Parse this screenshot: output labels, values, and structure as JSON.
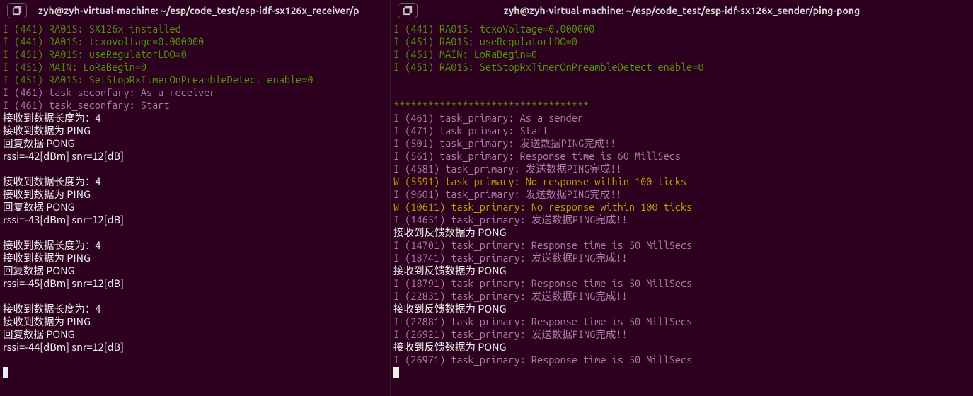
{
  "left": {
    "title": "zyh@zyh-virtual-machine: ~/esp/code_test/esp-idf-sx126x_receiver/p",
    "lines": [
      {
        "cls": "g",
        "text": "I (441) RA01S: SX126x installed"
      },
      {
        "cls": "g",
        "text": "I (441) RA01S: tcxoVoltage=0.000000"
      },
      {
        "cls": "g",
        "text": "I (451) RA01S: useRegulatorLDO=0"
      },
      {
        "cls": "g",
        "text": "I (451) MAIN: LoRaBegin=0"
      },
      {
        "cls": "g",
        "text": "I (451) RA01S: SetStopRxTimerOnPreambleDetect enable=0"
      },
      {
        "cls": "m",
        "text": "I (461) task_seconfary: As a receiver"
      },
      {
        "cls": "m",
        "text": "I (461) task_seconfary: Start"
      },
      {
        "cls": "w",
        "text": "接收到数据长度为：4"
      },
      {
        "cls": "w",
        "text": "接收到数据为 PING"
      },
      {
        "cls": "w",
        "text": "回复数据 PONG"
      },
      {
        "cls": "w",
        "text": "rssi=-42[dBm] snr=12[dB]"
      },
      {
        "cls": "w",
        "text": " "
      },
      {
        "cls": "w",
        "text": "接收到数据长度为：4"
      },
      {
        "cls": "w",
        "text": "接收到数据为 PING"
      },
      {
        "cls": "w",
        "text": "回复数据 PONG"
      },
      {
        "cls": "w",
        "text": "rssi=-43[dBm] snr=12[dB]"
      },
      {
        "cls": "w",
        "text": " "
      },
      {
        "cls": "w",
        "text": "接收到数据长度为：4"
      },
      {
        "cls": "w",
        "text": "接收到数据为 PING"
      },
      {
        "cls": "w",
        "text": "回复数据 PONG"
      },
      {
        "cls": "w",
        "text": "rssi=-45[dBm] snr=12[dB]"
      },
      {
        "cls": "w",
        "text": " "
      },
      {
        "cls": "w",
        "text": "接收到数据长度为：4"
      },
      {
        "cls": "w",
        "text": "接收到数据为 PING"
      },
      {
        "cls": "w",
        "text": "回复数据 PONG"
      },
      {
        "cls": "w",
        "text": "rssi=-44[dBm] snr=12[dB]"
      },
      {
        "cls": "w",
        "text": " "
      }
    ]
  },
  "right": {
    "title": "zyh@zyh-virtual-machine: ~/esp/code_test/esp-idf-sx126x_sender/ping-pong",
    "lines": [
      {
        "cls": "g",
        "text": "I (441) RA01S: tcxoVoltage=0.000000"
      },
      {
        "cls": "g",
        "text": "I (451) RA01S: useRegulatorLDO=0"
      },
      {
        "cls": "g",
        "text": "I (451) MAIN: LoRaBegin=0"
      },
      {
        "cls": "g",
        "text": "I (451) RA01S: SetStopRxTimerOnPreambleDetect enable=0"
      },
      {
        "cls": "w",
        "text": " "
      },
      {
        "cls": "w",
        "text": " "
      },
      {
        "cls": "stars",
        "text": "**********************************"
      },
      {
        "cls": "m",
        "text": "I (461) task_primary: As a sender"
      },
      {
        "cls": "m",
        "text": "I (471) task_primary: Start"
      },
      {
        "cls": "m",
        "text": "I (501) task_primary: 发送数据PING完成!!"
      },
      {
        "cls": "m",
        "text": "I (561) task_primary: Response time is 60 MillSecs"
      },
      {
        "cls": "m",
        "text": "I (4581) task_primary: 发送数据PING完成!!"
      },
      {
        "cls": "y",
        "text": "W (5591) task_primary: No response within 100 ticks"
      },
      {
        "cls": "m",
        "text": "I (9601) task_primary: 发送数据PING完成!!"
      },
      {
        "cls": "y",
        "text": "W (10611) task_primary: No response within 100 ticks"
      },
      {
        "cls": "m",
        "text": "I (14651) task_primary: 发送数据PING完成!!"
      },
      {
        "cls": "w",
        "text": "接收到反馈数据为 PONG"
      },
      {
        "cls": "m",
        "text": "I (14701) task_primary: Response time is 50 MillSecs"
      },
      {
        "cls": "m",
        "text": "I (18741) task_primary: 发送数据PING完成!!"
      },
      {
        "cls": "w",
        "text": "接收到反馈数据为 PONG"
      },
      {
        "cls": "m",
        "text": "I (18791) task_primary: Response time is 50 MillSecs"
      },
      {
        "cls": "m",
        "text": "I (22831) task_primary: 发送数据PING完成!!"
      },
      {
        "cls": "w",
        "text": "接收到反馈数据为 PONG"
      },
      {
        "cls": "m",
        "text": "I (22881) task_primary: Response time is 50 MillSecs"
      },
      {
        "cls": "m",
        "text": "I (26921) task_primary: 发送数据PING完成!!"
      },
      {
        "cls": "w",
        "text": "接收到反馈数据为 PONG"
      },
      {
        "cls": "m",
        "text": "I (26971) task_primary: Response time is 50 MillSecs"
      }
    ]
  }
}
